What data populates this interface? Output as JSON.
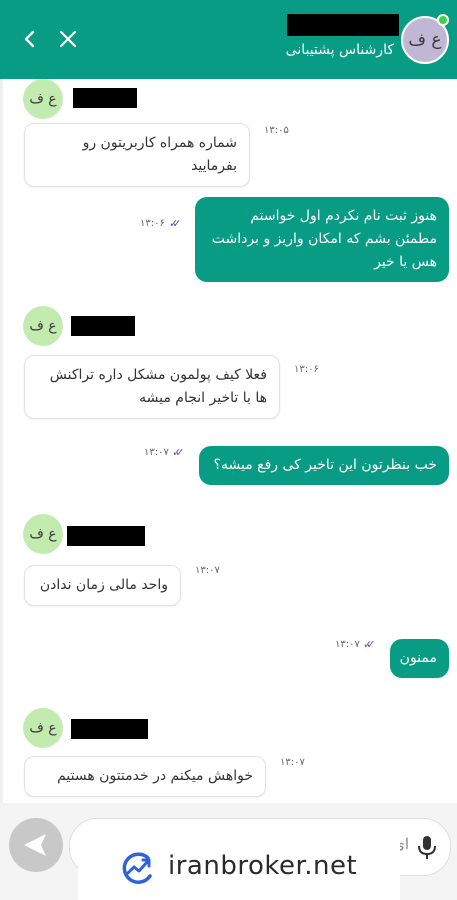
{
  "header": {
    "title": "کارشناس پشتیبانی",
    "avatar_initials": "ع ف",
    "back_icon": "‹",
    "close_icon": "✕"
  },
  "messages": [
    {
      "type": "in",
      "avatar": "ع ف",
      "text": "شماره همراه کاربریتون رو بفرمایید",
      "time": "۱۳:۰۵"
    },
    {
      "type": "out",
      "text": "هنوز ثبت نام نکردم اول خواستم مطمئن بشم که امکان واریز و برداشت هس یا خیر",
      "time": "۱۳:۰۶"
    },
    {
      "type": "in",
      "avatar": "ع ف",
      "text": "فعلا کیف پولمون مشکل داره تراکنش ها با تاخیر انجام میشه",
      "time": "۱۳:۰۶"
    },
    {
      "type": "out",
      "text": "خب بنظرتون این تاخیر کی رفع میشه؟",
      "time": "۱۳:۰۷"
    },
    {
      "type": "in",
      "avatar": "ع ف",
      "text": "واحد مالی زمان ندادن",
      "time": "۱۳:۰۷"
    },
    {
      "type": "out",
      "text": "ممنون",
      "time": "۱۳:۰۷"
    },
    {
      "type": "in",
      "avatar": "ع ف",
      "text": "خواهش میکنم در خدمتتون هستیم",
      "time": "۱۳:۰۷"
    }
  ],
  "input": {
    "placeholder_partial": "ای"
  },
  "watermark": {
    "text": "iranbroker.net"
  },
  "colors": {
    "accent": "#089c84",
    "read_tick": "#7b3db2",
    "agent_avatar": "#c3ebb0"
  }
}
